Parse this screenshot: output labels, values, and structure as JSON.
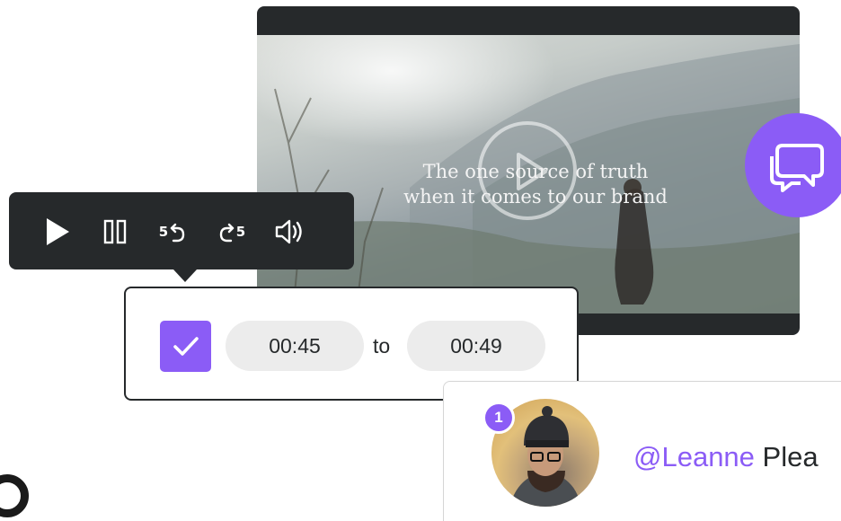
{
  "video": {
    "caption_line1": "The one source of truth",
    "caption_line2": "when it comes to our brand",
    "play_icon": "play-circle-icon"
  },
  "chat_button": {
    "icon": "chat-bubbles-icon"
  },
  "controls": {
    "play_icon": "play-icon",
    "pause_icon": "pause-icon",
    "rewind_label": "5",
    "rewind_icon": "rewind-icon",
    "forward_label": "5",
    "forward_icon": "forward-icon",
    "volume_icon": "volume-icon"
  },
  "range": {
    "checked": true,
    "start": "00:45",
    "to_label": "to",
    "end": "00:49"
  },
  "comment": {
    "badge_count": "1",
    "mention": "@Leanne",
    "text": " Plea"
  },
  "colors": {
    "accent": "#8b5cf6",
    "dark": "#26292b",
    "pill": "#ececec"
  }
}
